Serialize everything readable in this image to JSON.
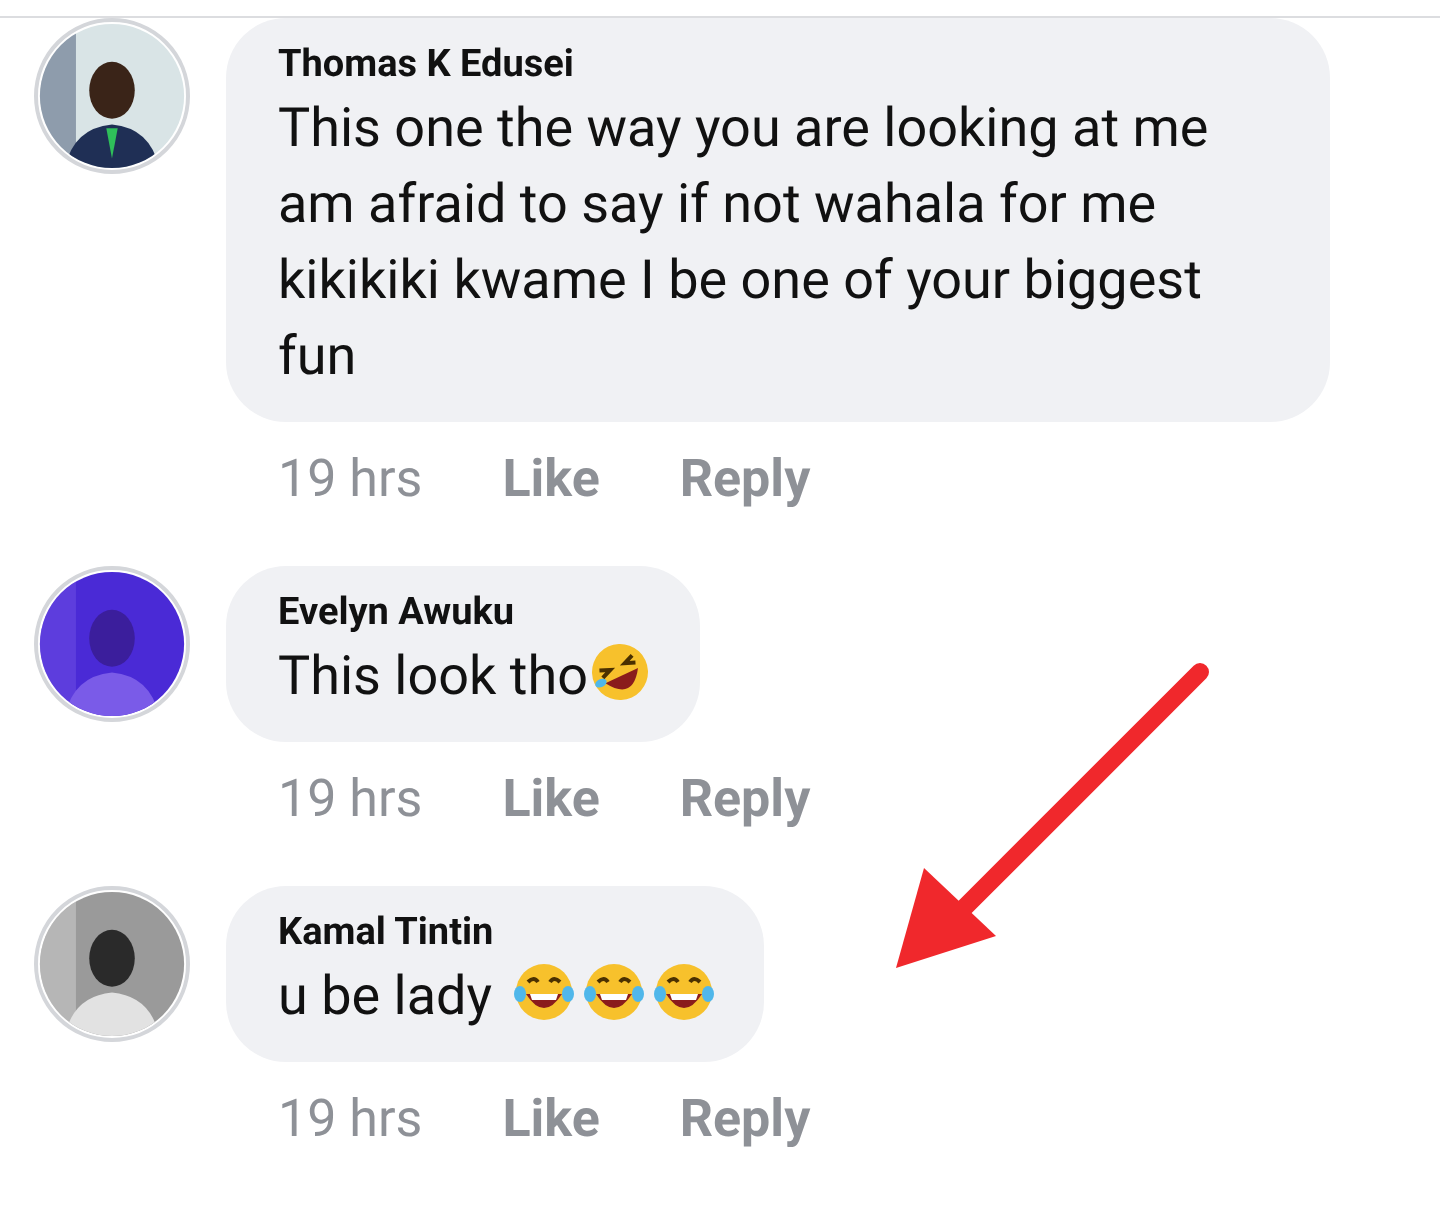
{
  "comments": [
    {
      "author": "Thomas K Edusei",
      "text": "This one the way you are looking at me am afraid to say if not wahala for me kikikiki kwame I be one of your biggest fun",
      "time": "19 hrs",
      "like": "Like",
      "reply": "Reply"
    },
    {
      "author": "Evelyn Awuku",
      "text": "This look tho",
      "emojis": [
        {
          "kind": "rolling"
        }
      ],
      "time": "19 hrs",
      "like": "Like",
      "reply": "Reply"
    },
    {
      "author": "Kamal Tintin",
      "text": "u be lady ",
      "emojis": [
        {
          "kind": "tears"
        },
        {
          "kind": "tears"
        },
        {
          "kind": "tears"
        }
      ],
      "time": "19 hrs",
      "like": "Like",
      "reply": "Reply"
    }
  ]
}
